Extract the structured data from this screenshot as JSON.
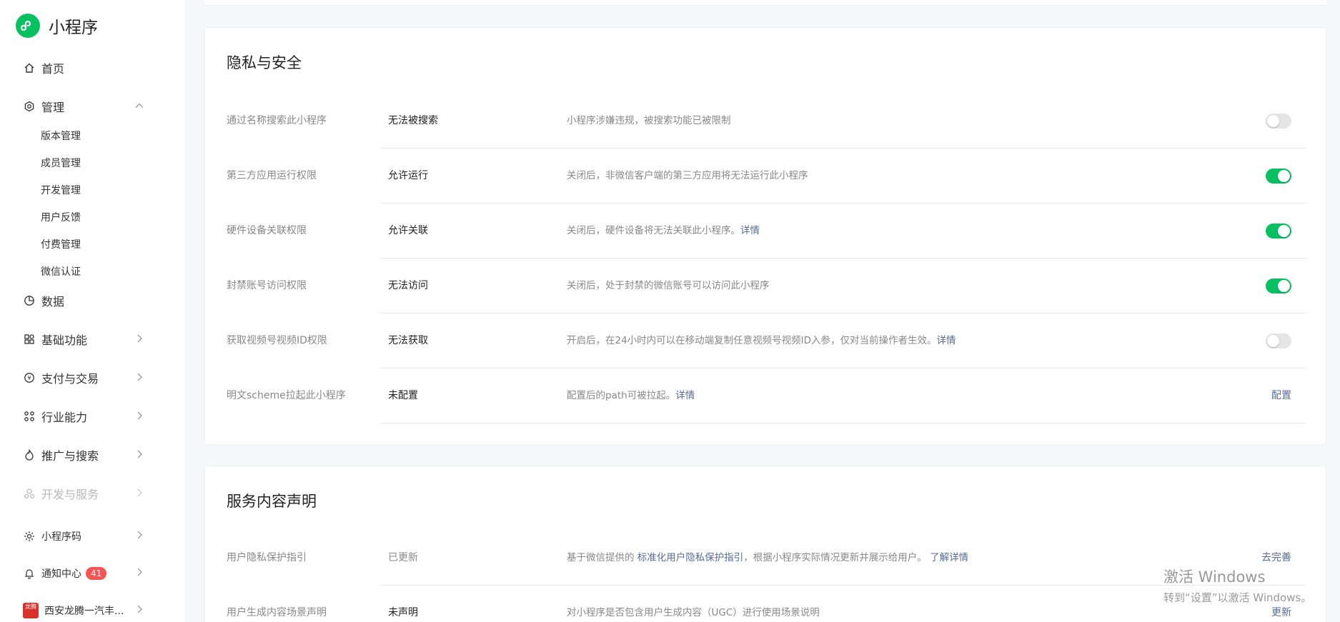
{
  "app": {
    "title": "小程序"
  },
  "sidebar": {
    "home": "首页",
    "manage": "管理",
    "manage_sub": [
      "版本管理",
      "成员管理",
      "开发管理",
      "用户反馈",
      "付费管理",
      "微信认证"
    ],
    "data": "数据",
    "basic": "基础功能",
    "pay": "支付与交易",
    "industry": "行业能力",
    "promo": "推广与搜索",
    "devsvc": "开发与服务",
    "qrcode": "小程序码",
    "notify": "通知中心",
    "notify_count": "41",
    "account": "西安龙腾一汽丰...",
    "account_avatar_text": "龙腾"
  },
  "privacy": {
    "title": "隐私与安全",
    "rows": [
      {
        "name": "通过名称搜索此小程序",
        "status": "无法被搜索",
        "desc": "小程序涉嫌违规，被搜索功能已被限制",
        "link": "",
        "toggle_on": false
      },
      {
        "name": "第三方应用运行权限",
        "status": "允许运行",
        "desc": "关闭后，非微信客户端的第三方应用将无法运行此小程序",
        "link": "",
        "toggle_on": true
      },
      {
        "name": "硬件设备关联权限",
        "status": "允许关联",
        "desc": "关闭后，硬件设备将无法关联此小程序。",
        "link": "详情",
        "toggle_on": true
      },
      {
        "name": "封禁账号访问权限",
        "status": "无法访问",
        "desc": "关闭后，处于封禁的微信账号可以访问此小程序",
        "link": "",
        "toggle_on": true
      },
      {
        "name": "获取视频号视频ID权限",
        "status": "无法获取",
        "desc": "开启后，在24小时内可以在移动端复制任意视频号视频ID入参，仅对当前操作者生效。",
        "link": "详情",
        "toggle_on": false
      },
      {
        "name": "明文scheme拉起此小程序",
        "status": "未配置",
        "desc": "配置后的path可被拉起。",
        "link": "详情",
        "action": "配置"
      }
    ]
  },
  "service": {
    "title": "服务内容声明",
    "rows": [
      {
        "name": "用户隐私保护指引",
        "status": "已更新",
        "desc_pre": "基于微信提供的 ",
        "desc_link": "标准化用户隐私保护指引",
        "desc_post": "，根据小程序实际情况更新并展示给用户。 ",
        "desc_link2": "了解详情",
        "action": "去完善"
      },
      {
        "name": "用户生成内容场景声明",
        "status": "未声明",
        "desc": "对小程序是否包含用户生成内容（UGC）进行使用场景说明",
        "action": "更新"
      }
    ]
  },
  "watermark": {
    "line1": "激活 Windows",
    "line2": "转到“设置”以激活 Windows。"
  },
  "colors": {
    "brand": "#07c160",
    "link": "#576b95",
    "badge": "#fa5151"
  }
}
